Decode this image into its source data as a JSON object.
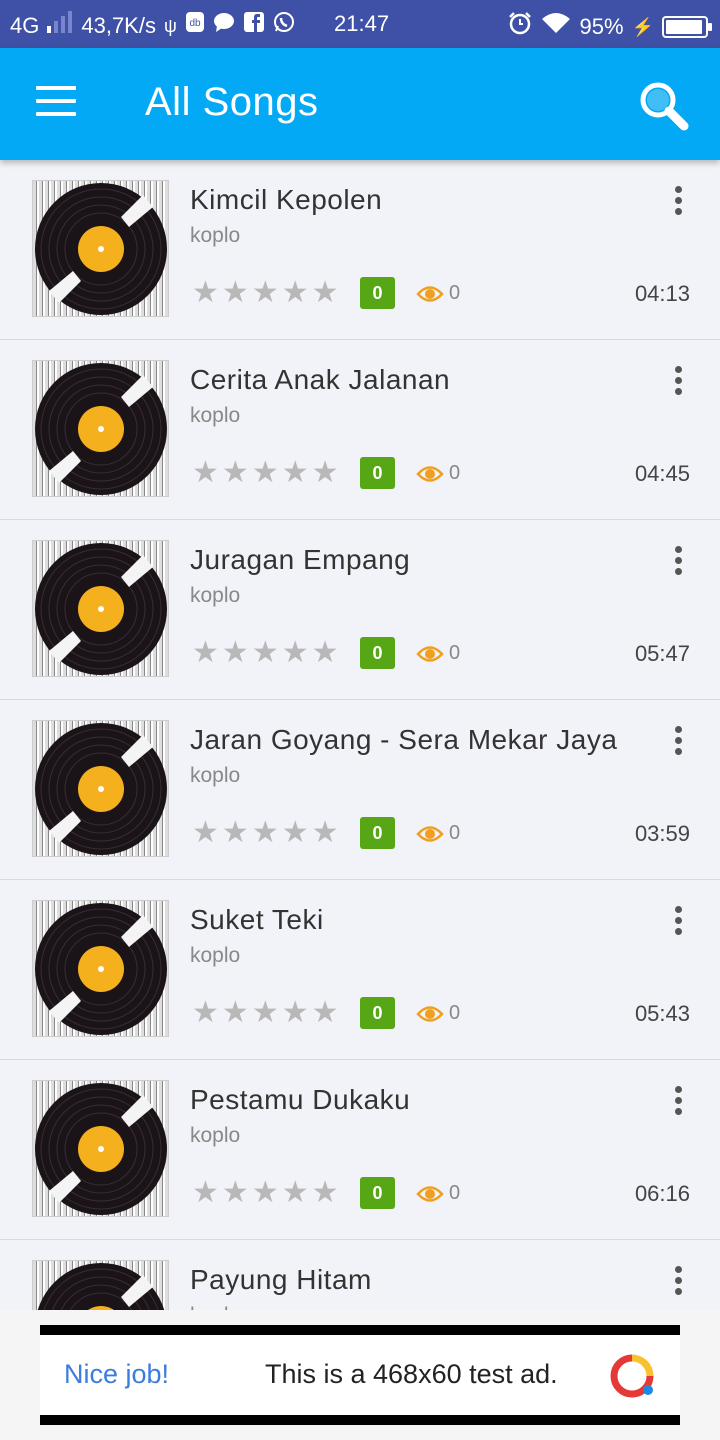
{
  "status_bar": {
    "network": "4G",
    "speed": "43,7K/s",
    "time": "21:47",
    "battery_percent": "95%",
    "battery_level": 0.95
  },
  "app_bar": {
    "title": "All Songs"
  },
  "songs": [
    {
      "title": "Kimcil Kepolen",
      "category": "koplo",
      "rating": "0",
      "views": "0",
      "duration": "04:13"
    },
    {
      "title": "Cerita Anak Jalanan",
      "category": "koplo",
      "rating": "0",
      "views": "0",
      "duration": "04:45"
    },
    {
      "title": "Juragan Empang",
      "category": "koplo",
      "rating": "0",
      "views": "0",
      "duration": "05:47"
    },
    {
      "title": "Jaran Goyang - Sera Mekar Jaya",
      "category": "koplo",
      "rating": "0",
      "views": "0",
      "duration": "03:59"
    },
    {
      "title": "Suket Teki",
      "category": "koplo",
      "rating": "0",
      "views": "0",
      "duration": "05:43"
    },
    {
      "title": " Pestamu Dukaku",
      "category": "koplo",
      "rating": "0",
      "views": "0",
      "duration": "06:16"
    },
    {
      "title": "Payung Hitam",
      "category": "koplo",
      "rating": "",
      "views": "",
      "duration": ""
    }
  ],
  "ad": {
    "left_text": "Nice job!",
    "text": "This is a 468x60 test ad."
  },
  "colors": {
    "status_bar": "#3f51a6",
    "app_bar": "#03a9f4",
    "rating_badge": "#56a615",
    "views_icon": "#f0a020"
  },
  "icons": {
    "menu": "hamburger-icon",
    "search": "search-icon",
    "more": "more-vertical-icon",
    "star": "star-icon",
    "views": "eye-icon",
    "cover": "vinyl-record-icon"
  }
}
